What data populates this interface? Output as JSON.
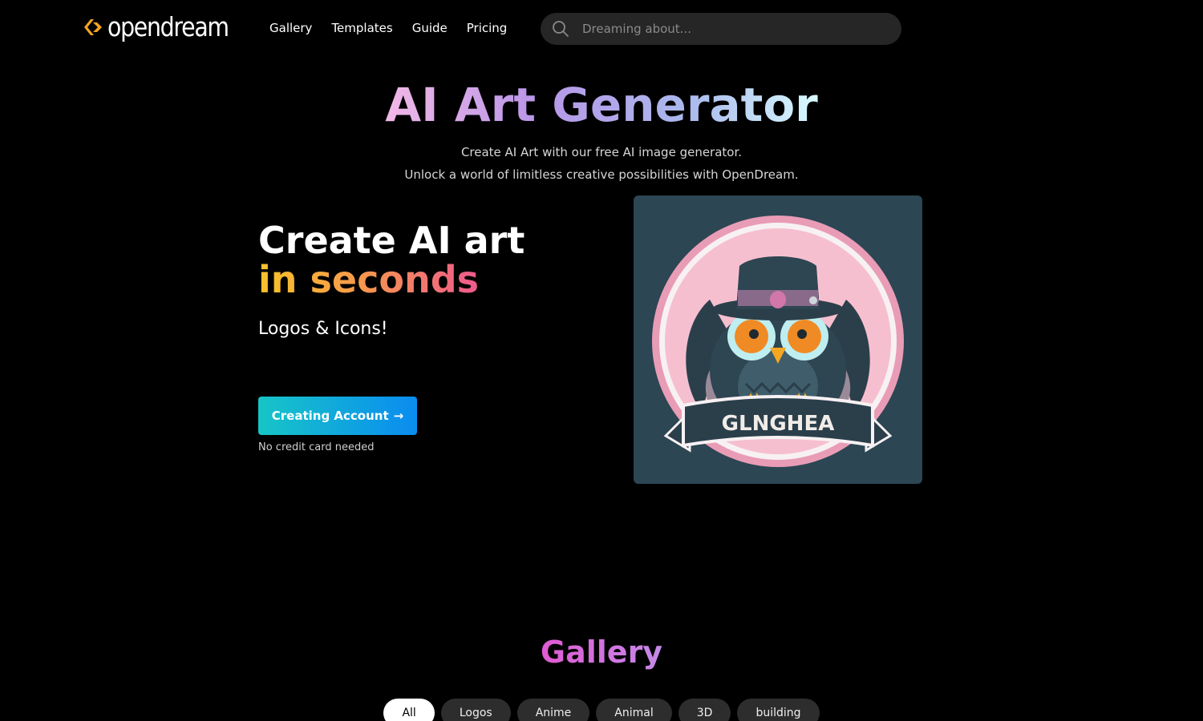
{
  "brand": {
    "name": "opendream",
    "accent": "#f5a623"
  },
  "nav": {
    "items": [
      {
        "label": "Gallery"
      },
      {
        "label": "Templates"
      },
      {
        "label": "Guide"
      },
      {
        "label": "Pricing"
      }
    ]
  },
  "search": {
    "placeholder": "Dreaming about...",
    "value": "",
    "icon": "search-icon"
  },
  "hero": {
    "title": "AI Art Generator",
    "subtitle_line1": "Create AI Art with our free AI image generator.",
    "subtitle_line2": "Unlock a world of limitless creative possibilities with OpenDream."
  },
  "promo": {
    "headline_line1": "Create AI art",
    "headline_line2": "in seconds",
    "tagline": "Logos & Icons!",
    "cta_label": "Creating Account",
    "cta_arrow": "→",
    "note": "No credit card needed"
  },
  "artwork": {
    "banner_text": "GLNGHEA"
  },
  "gallery": {
    "title": "Gallery",
    "filters": [
      {
        "label": "All",
        "active": true
      },
      {
        "label": "Logos",
        "active": false
      },
      {
        "label": "Anime",
        "active": false
      },
      {
        "label": "Animal",
        "active": false
      },
      {
        "label": "3D",
        "active": false
      },
      {
        "label": "building",
        "active": false
      }
    ]
  },
  "colors": {
    "cta_gradient_start": "#17c5c7",
    "cta_gradient_end": "#0a8cf0",
    "search_bg": "#262626",
    "chip_bg": "#2d2d2d"
  }
}
